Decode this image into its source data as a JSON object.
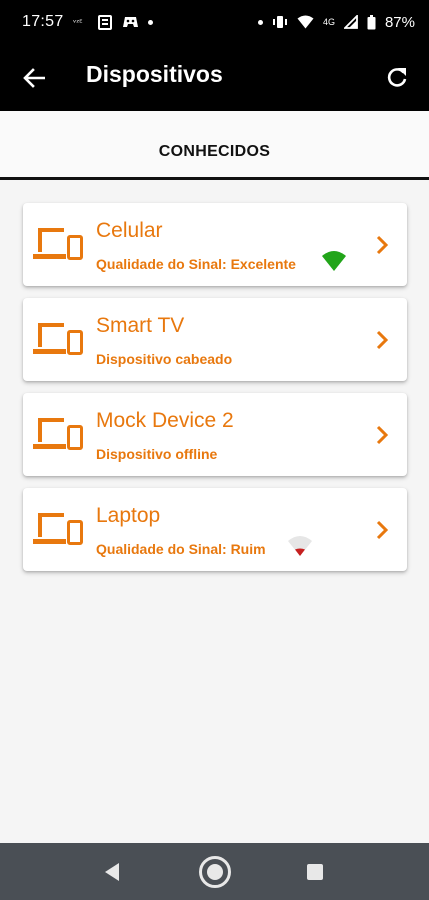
{
  "status_bar": {
    "time": "17:57",
    "network": "4G",
    "battery": "87%"
  },
  "app_bar": {
    "title": "Dispositivos"
  },
  "tab": {
    "label": "CONHECIDOS"
  },
  "devices": [
    {
      "name": "Celular",
      "status": "Qualidade do Sinal: Excelente",
      "signal": "excellent",
      "signal_color": "#22a51a"
    },
    {
      "name": "Smart TV",
      "status": "Dispositivo cabeado",
      "signal": "none"
    },
    {
      "name": "Mock Device 2",
      "status": "Dispositivo offline",
      "signal": "none"
    },
    {
      "name": "Laptop",
      "status": "Qualidade do Sinal: Ruim",
      "signal": "poor",
      "signal_color": "#c62020"
    }
  ],
  "colors": {
    "accent": "#e8780e",
    "app_bar": "#000000",
    "nav_bar": "#4a4f55"
  }
}
